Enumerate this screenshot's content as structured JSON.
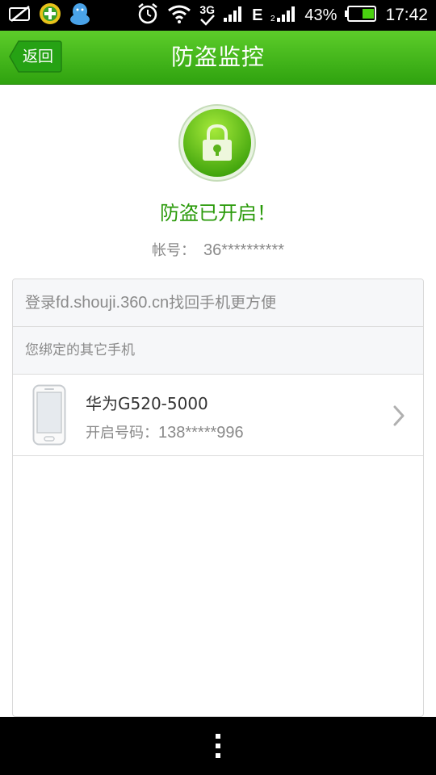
{
  "status_bar": {
    "battery_percent": "43%",
    "time": "17:42",
    "network_label": "3G",
    "edge_label": "E",
    "icons": [
      "no-sim-icon",
      "360-security-icon",
      "qq-icon",
      "alarm-icon",
      "wifi-icon",
      "3g-icon",
      "signal-icon",
      "edge-icon",
      "signal-2-icon",
      "battery-icon"
    ]
  },
  "header": {
    "back_label": "返回",
    "title": "防盗监控"
  },
  "lock": {
    "icon": "lock-icon",
    "status_text": "防盗已开启！",
    "account_label": "帐号：",
    "account_value": "36**********"
  },
  "card": {
    "login_hint_prefix": "登录",
    "login_hint_link": "fd.shouji.360.cn",
    "login_hint_suffix": "找回手机更方便",
    "bound_section_title": "您绑定的其它手机",
    "phones": [
      {
        "name": "华为G520-5000",
        "number_label": "开启号码：",
        "number_value": "138*****996"
      }
    ]
  },
  "colors": {
    "header_green": "#3db51a",
    "status_green": "#2a9a0a",
    "gray_text": "#8a8a8a"
  }
}
